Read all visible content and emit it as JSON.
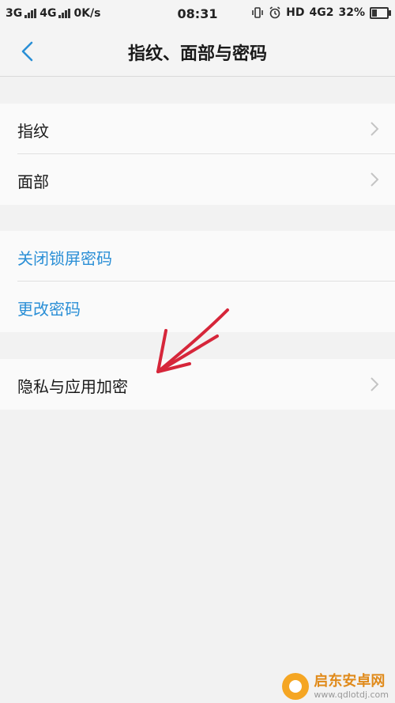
{
  "status_bar": {
    "net1": "3G",
    "net2": "4G",
    "speed": "0K/s",
    "time": "08:31",
    "hd": "HD",
    "net3": "4G2",
    "battery": "32%",
    "battery_level": 0.32
  },
  "header": {
    "title": "指纹、面部与密码"
  },
  "group1": {
    "items": [
      {
        "label": "指纹"
      },
      {
        "label": "面部"
      }
    ]
  },
  "group2": {
    "items": [
      {
        "label": "关闭锁屏密码"
      },
      {
        "label": "更改密码"
      }
    ]
  },
  "group3": {
    "items": [
      {
        "label": "隐私与应用加密"
      }
    ]
  },
  "colors": {
    "link": "#2a8fd6",
    "back_icon": "#2a8fd6",
    "annotation_arrow": "#d6263a"
  },
  "watermark": {
    "name": "启东安卓网",
    "url": "www.qdlotdj.com"
  }
}
